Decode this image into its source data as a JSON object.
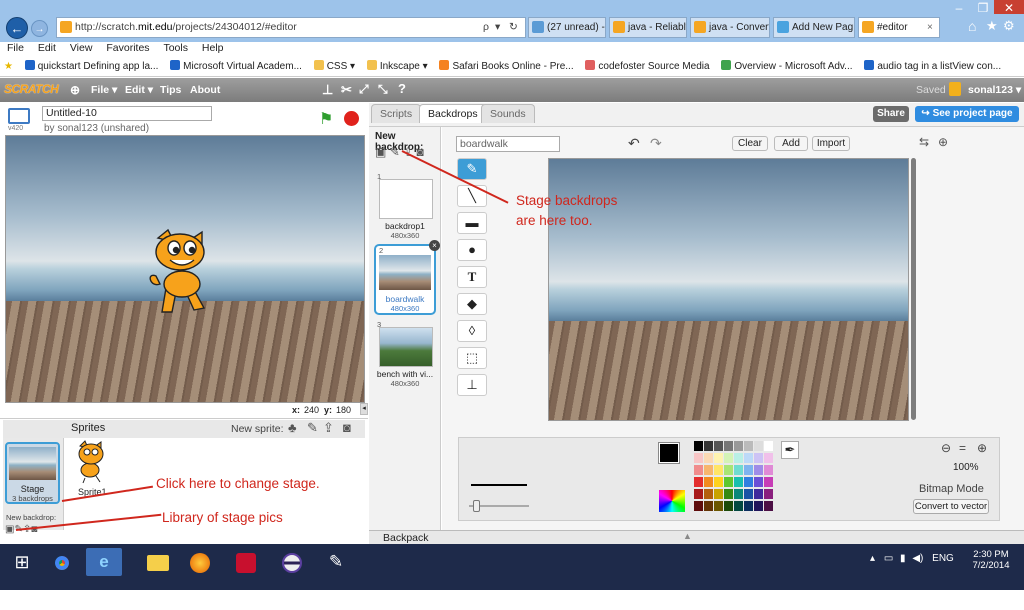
{
  "browser": {
    "url_prefix": "http://scratch.",
    "url_domain": "mit.edu",
    "url_path": "/projects/24304012/#editor",
    "search_symbol": "ρ",
    "tabs": [
      {
        "label": "(27 unread) - ...",
        "color": "#5b9bd5"
      },
      {
        "label": "java - Reliably...",
        "color": "#f5a623"
      },
      {
        "label": "java - Convert...",
        "color": "#f5a623"
      },
      {
        "label": "Add New Pag...",
        "color": "#4aa3df"
      },
      {
        "label": "#editor",
        "color": "#f5a623",
        "active": true
      }
    ],
    "tab_close": "×"
  },
  "menu": [
    "File",
    "Edit",
    "View",
    "Favorites",
    "Tools",
    "Help"
  ],
  "favorites": [
    {
      "label": "quickstart Defining app la...",
      "color": "#1e64c8"
    },
    {
      "label": "Microsoft Virtual Academ...",
      "color": "#1e64c8"
    },
    {
      "label": "CSS ▾",
      "color": "#f2c14e"
    },
    {
      "label": "Inkscape ▾",
      "color": "#f2c14e"
    },
    {
      "label": "Safari Books Online - Pre...",
      "color": "#f58220"
    },
    {
      "label": "codefoster Source Media",
      "color": "#e05f5f"
    },
    {
      "label": "Overview - Microsoft Adv...",
      "color": "#3fa34d"
    },
    {
      "label": "audio tag in a listView con...",
      "color": "#1e64c8"
    }
  ],
  "scratch": {
    "logo": "SCRATCH",
    "menu": [
      "File ▾",
      "Edit ▾",
      "Tips",
      "About"
    ],
    "saved": "Saved",
    "user": "sonal123 ▾",
    "project_title": "Untitled-10",
    "byline": "by sonal123 (unshared)",
    "version": "v420",
    "tabs": [
      "Scripts",
      "Backdrops",
      "Sounds"
    ],
    "share": "Share",
    "see_project": "See project page",
    "coords_x_label": "x:",
    "coords_x": "240",
    "coords_y_label": "y:",
    "coords_y": "180",
    "sprites_label": "Sprites",
    "new_sprite": "New sprite:",
    "stage_label": "Stage",
    "stage_count": "3 backdrops",
    "sprite1": "Sprite1",
    "new_backdrop": "New backdrop:",
    "backdrop_header": "New backdrop:",
    "backdrops": [
      {
        "index": "1",
        "name": "backdrop1",
        "size": "480x360"
      },
      {
        "index": "2",
        "name": "boardwalk",
        "size": "480x360"
      },
      {
        "index": "3",
        "name": "bench with vi...",
        "size": "480x360"
      }
    ],
    "costume_name": "boardwalk",
    "buttons": {
      "clear": "Clear",
      "add": "Add",
      "import": "Import"
    },
    "zoom": "100%",
    "mode": "Bitmap Mode",
    "convert": "Convert to vector",
    "backpack": "Backpack"
  },
  "annotations": {
    "backdrops": "Stage backdrops\nare here too.",
    "click_stage": "Click here to change stage.",
    "library": "Library of stage pics"
  },
  "taskbar": {
    "time": "2:30 PM",
    "date": "7/2/2014",
    "lang": "ENG"
  }
}
